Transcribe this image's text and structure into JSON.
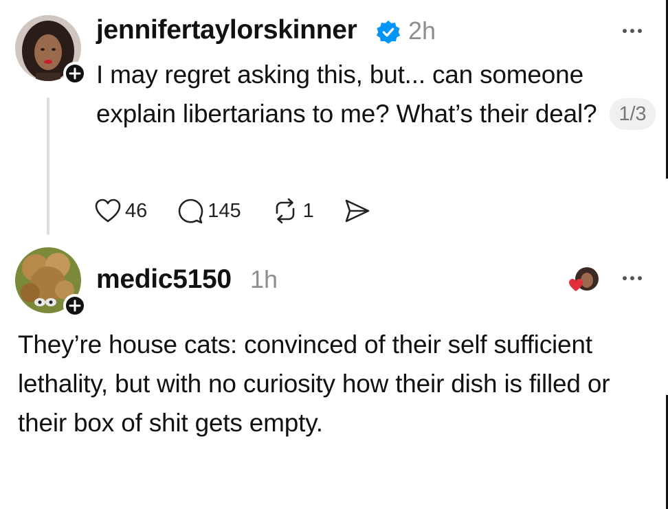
{
  "posts": [
    {
      "username": "jennifertaylorskinner",
      "verified": true,
      "time": "2h",
      "text": "I may regret asking this, but... can someone explain libertarians to me? What’s their deal?",
      "thread_counter": "1/3",
      "actions": {
        "likes": "46",
        "replies": "145",
        "reposts": "1"
      }
    },
    {
      "username": "medic5150",
      "time": "1h",
      "text": "They’re house cats: convinced of their self sufficient lethality, but with no curiosity how their dish is filled  or their box of shit gets empty."
    }
  ],
  "icons": {
    "verified": "verified-badge-icon",
    "more": "more-options-icon",
    "like": "heart-icon",
    "reply": "comment-icon",
    "repost": "repost-icon",
    "share": "send-icon",
    "follow": "plus-icon"
  },
  "colors": {
    "verified_blue": "#0095f6",
    "text": "#111111",
    "muted": "#8e8e8e",
    "pill_bg": "#f0f0f0"
  }
}
